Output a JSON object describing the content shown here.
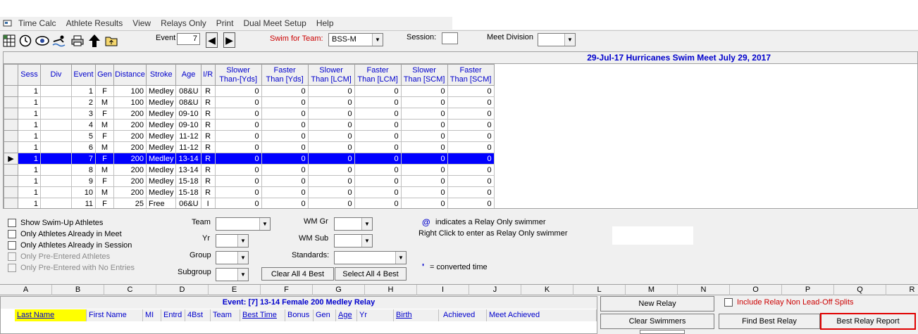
{
  "menu": [
    "Time Calc",
    "Athlete Results",
    "View",
    "Relays Only",
    "Print",
    "Dual Meet Setup",
    "Help"
  ],
  "toolbar": {
    "event_label": "Event",
    "event_value": "7",
    "swim_for_team_label": "Swim for Team:",
    "swim_for_team_value": "BSS-M",
    "session_label": "Session:",
    "session_value": "",
    "meet_division_label": "Meet Division",
    "meet_division_value": ""
  },
  "meet_title": "29-Jul-17  Hurricanes Swim Meet July 29, 2017",
  "event_table": {
    "columns": [
      "Sess",
      "Div",
      "Event",
      "Gen",
      "Distance",
      "Stroke",
      "Age",
      "I/R",
      "Slower Than-[Yds]",
      "Faster Than [Yds]",
      "Slower Than [LCM]",
      "Faster Than [LCM]",
      "Slower Than [SCM]",
      "Faster Than [SCM]"
    ],
    "header_lines": [
      [
        "Sess"
      ],
      [
        "Div"
      ],
      [
        "Event"
      ],
      [
        "Gen"
      ],
      [
        "Distance"
      ],
      [
        "Stroke"
      ],
      [
        "Age"
      ],
      [
        "I/R"
      ],
      [
        "Slower",
        "Than-[Yds]"
      ],
      [
        "Faster",
        "Than [Yds]"
      ],
      [
        "Slower",
        "Than [LCM]"
      ],
      [
        "Faster",
        "Than [LCM]"
      ],
      [
        "Slower",
        "Than [SCM]"
      ],
      [
        "Faster",
        "Than [SCM]"
      ]
    ],
    "rows": [
      [
        "1",
        "",
        "1",
        "F",
        "100",
        "Medley",
        "08&U",
        "R",
        "0",
        "0",
        "0",
        "0",
        "0",
        "0"
      ],
      [
        "1",
        "",
        "2",
        "M",
        "100",
        "Medley",
        "08&U",
        "R",
        "0",
        "0",
        "0",
        "0",
        "0",
        "0"
      ],
      [
        "1",
        "",
        "3",
        "F",
        "200",
        "Medley",
        "09-10",
        "R",
        "0",
        "0",
        "0",
        "0",
        "0",
        "0"
      ],
      [
        "1",
        "",
        "4",
        "M",
        "200",
        "Medley",
        "09-10",
        "R",
        "0",
        "0",
        "0",
        "0",
        "0",
        "0"
      ],
      [
        "1",
        "",
        "5",
        "F",
        "200",
        "Medley",
        "11-12",
        "R",
        "0",
        "0",
        "0",
        "0",
        "0",
        "0"
      ],
      [
        "1",
        "",
        "6",
        "M",
        "200",
        "Medley",
        "11-12",
        "R",
        "0",
        "0",
        "0",
        "0",
        "0",
        "0"
      ],
      [
        "1",
        "",
        "7",
        "F",
        "200",
        "Medley",
        "13-14",
        "R",
        "0",
        "0",
        "0",
        "0",
        "0",
        "0"
      ],
      [
        "1",
        "",
        "8",
        "M",
        "200",
        "Medley",
        "13-14",
        "R",
        "0",
        "0",
        "0",
        "0",
        "0",
        "0"
      ],
      [
        "1",
        "",
        "9",
        "F",
        "200",
        "Medley",
        "15-18",
        "R",
        "0",
        "0",
        "0",
        "0",
        "0",
        "0"
      ],
      [
        "1",
        "",
        "10",
        "M",
        "200",
        "Medley",
        "15-18",
        "R",
        "0",
        "0",
        "0",
        "0",
        "0",
        "0"
      ],
      [
        "1",
        "",
        "11",
        "F",
        "25",
        "Free",
        "06&U",
        "I",
        "0",
        "0",
        "0",
        "0",
        "0",
        "0"
      ]
    ],
    "selected_row": 6
  },
  "filters": {
    "checkboxes": [
      {
        "label": "Show Swim-Up Athletes",
        "disabled": false
      },
      {
        "label": "Only Athletes Already in Meet",
        "disabled": false
      },
      {
        "label": "Only Athletes Already in Session",
        "disabled": false
      },
      {
        "label": "Only Pre-Entered Athletes",
        "disabled": true
      },
      {
        "label": "Only Pre-Entered with No Entries",
        "disabled": true
      }
    ],
    "team_label": "Team",
    "yr_label": "Yr",
    "group_label": "Group",
    "subgroup_label": "Subgroup",
    "wm_gr_label": "WM Gr",
    "wm_sub_label": "WM Sub",
    "standards_label": "Standards:",
    "clear_all_label": "Clear All 4 Best",
    "select_all_label": "Select All 4 Best",
    "relay_at_symbol": "@",
    "relay_note_1": "indicates a Relay Only swimmer",
    "relay_note_2": "Right Click to enter as Relay Only swimmer",
    "converted_mark": "'",
    "converted_note": "= converted time"
  },
  "column_letters": [
    "A",
    "B",
    "C",
    "D",
    "E",
    "F",
    "G",
    "H",
    "I",
    "J",
    "K",
    "L",
    "M",
    "N",
    "O",
    "P",
    "Q",
    "R"
  ],
  "swimmers": {
    "title": "Event: [7]  13-14  Female  200  Medley Relay",
    "headers": [
      "Last Name",
      "First Name",
      "MI",
      "Entrd",
      "4Bst",
      "Team",
      "Best Time",
      "Bonus",
      "Gen",
      "Age",
      "Yr",
      "Birth",
      "Achieved",
      "Meet Achieved"
    ]
  },
  "relay_buttons": {
    "new_relay": "New Relay",
    "clear_swimmers": "Clear Swimmers",
    "find_best_relay": "Find Best Relay",
    "best_relay_report": "Best Relay Report",
    "include_non_leadoff": "Include Relay Non Lead-Off Splits"
  },
  "colors": {
    "selection": "#0000ff",
    "header_text": "#0000cc",
    "highlight_border": "#e00000",
    "last_name_bg": "#ffff00",
    "label_red": "#cc0000"
  }
}
